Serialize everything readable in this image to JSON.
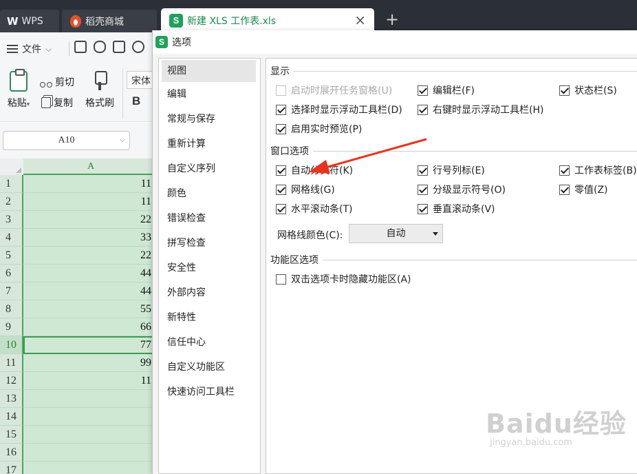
{
  "tabs": {
    "wps": "WPS",
    "mall": "稻壳商城",
    "file": "新建 XLS 工作表.xls",
    "close_icon": "×",
    "new_tab_icon": "+"
  },
  "ribbon": {
    "file_menu": "文件",
    "paste": "粘贴",
    "cut": "剪切",
    "copy": "复制",
    "format_painter": "格式刷",
    "font_name": "宋体",
    "bold": "B"
  },
  "name_box": "A10",
  "grid": {
    "column_header": "A",
    "rows": [
      {
        "num": "1",
        "value": "11"
      },
      {
        "num": "2",
        "value": "11"
      },
      {
        "num": "3",
        "value": "22"
      },
      {
        "num": "4",
        "value": "33"
      },
      {
        "num": "5",
        "value": "22"
      },
      {
        "num": "6",
        "value": "44"
      },
      {
        "num": "7",
        "value": "44"
      },
      {
        "num": "8",
        "value": "55"
      },
      {
        "num": "9",
        "value": "66"
      },
      {
        "num": "10",
        "value": "77"
      },
      {
        "num": "11",
        "value": "99"
      },
      {
        "num": "12",
        "value": "11"
      },
      {
        "num": "13",
        "value": ""
      },
      {
        "num": "14",
        "value": ""
      },
      {
        "num": "15",
        "value": ""
      },
      {
        "num": "16",
        "value": ""
      },
      {
        "num": "17",
        "value": ""
      }
    ]
  },
  "dialog": {
    "title": "选项",
    "nav": [
      "视图",
      "编辑",
      "常规与保存",
      "重新计算",
      "自定义序列",
      "颜色",
      "错误检查",
      "拼写检查",
      "安全性",
      "外部内容",
      "新特性",
      "信任中心",
      "自定义功能区",
      "快速访问工具栏"
    ],
    "sections": {
      "display": "显示",
      "window": "窗口选项",
      "ribbon": "功能区选项"
    },
    "display_options": {
      "startup_taskpane": "启动时展开任务窗格(U)",
      "formula_bar": "编辑栏(F)",
      "status_bar": "状态栏(S)",
      "float_toolbar_select": "选择时显示浮动工具栏(D)",
      "float_toolbar_rightclick": "右键时显示浮动工具栏(H)",
      "live_preview": "启用实时预览(P)"
    },
    "window_options": {
      "auto_page_break": "自动分页符(K)",
      "row_col_headers": "行号列标(E)",
      "sheet_tabs": "工作表标签(B)",
      "gridlines": "网格线(G)",
      "outline_symbols": "分级显示符号(O)",
      "zero_values": "零值(Z)",
      "h_scrollbar": "水平滚动条(T)",
      "v_scrollbar": "垂直滚动条(V)"
    },
    "gridline_color_label": "网格线颜色(C):",
    "gridline_color_value": "自动",
    "ribbon_options": {
      "hide_on_dblclick": "双击选项卡时隐藏功能区(A)"
    }
  },
  "watermark": {
    "main": "Baidu经验",
    "sub": "jingyan.baidu.com"
  },
  "colors": {
    "accent_green": "#1fa15a",
    "selection_green": "#cfe8d3",
    "annotation_red": "#e8341c"
  }
}
